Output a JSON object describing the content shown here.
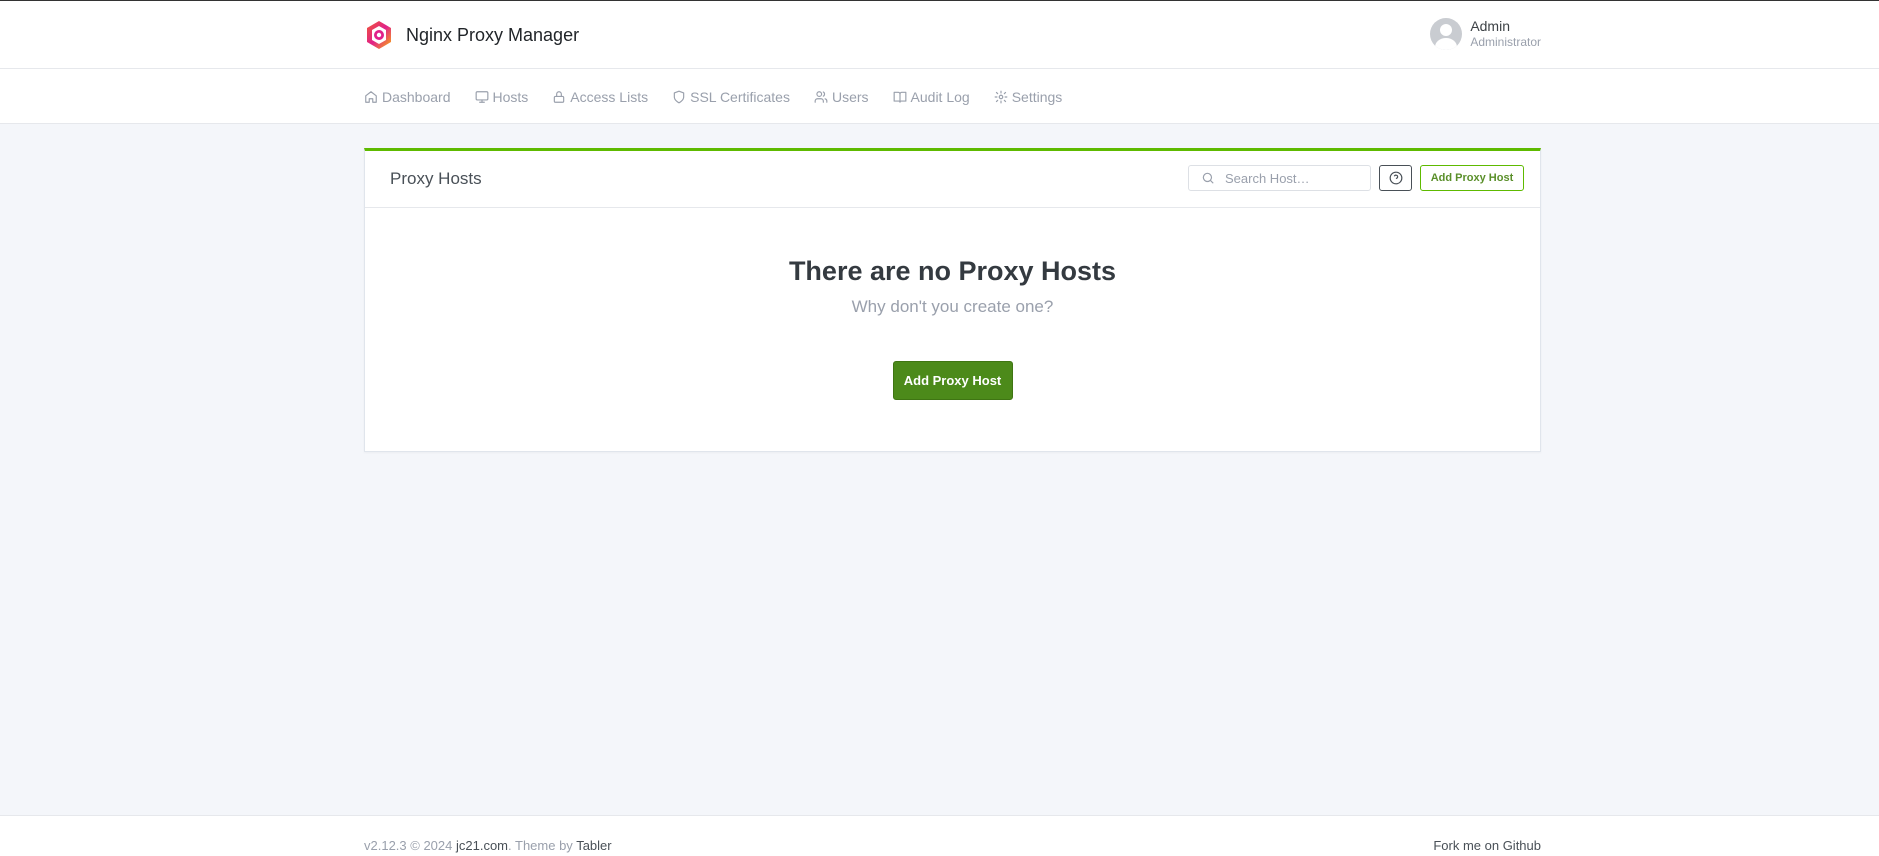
{
  "header": {
    "brand_name": "Nginx Proxy Manager",
    "user_name": "Admin",
    "user_role": "Administrator"
  },
  "nav": {
    "items": [
      {
        "label": "Dashboard",
        "icon": "home-icon"
      },
      {
        "label": "Hosts",
        "icon": "monitor-icon"
      },
      {
        "label": "Access Lists",
        "icon": "lock-icon"
      },
      {
        "label": "SSL Certificates",
        "icon": "shield-icon"
      },
      {
        "label": "Users",
        "icon": "users-icon"
      },
      {
        "label": "Audit Log",
        "icon": "book-icon"
      },
      {
        "label": "Settings",
        "icon": "gear-icon"
      }
    ]
  },
  "card": {
    "title": "Proxy Hosts",
    "search_placeholder": "Search Host…",
    "add_button_label": "Add Proxy Host",
    "empty_title": "There are no Proxy Hosts",
    "empty_subtitle": "Why don't you create one?",
    "empty_button_label": "Add Proxy Host"
  },
  "footer": {
    "version": "v2.12.3 © 2024 ",
    "company_link": "jc21.com",
    "theme_prefix": ". Theme by ",
    "theme_link": "Tabler",
    "github_link": "Fork me on Github"
  },
  "colors": {
    "accent": "#5eba00",
    "primary_button": "#4c8a1a",
    "background": "#f4f6fa"
  }
}
